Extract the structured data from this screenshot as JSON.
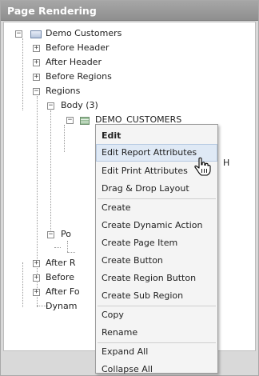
{
  "panel": {
    "title": "Page Rendering"
  },
  "tree": {
    "root": "Demo Customers",
    "before_header": "Before Header",
    "after_header": "After Header",
    "before_regions": "Before Regions",
    "regions": "Regions",
    "body": "Body (3)",
    "demo_customers": "DEMO_CUSTOMERS",
    "partial_po": "Po",
    "partial_after_r": "After R",
    "partial_before": "Before",
    "partial_after_f": "After Fo",
    "partial_dynam": "Dynam",
    "hidden_text_h": "H"
  },
  "context_menu": {
    "items": [
      {
        "label": "Edit"
      },
      {
        "label": "Edit Report Attributes"
      },
      {
        "label": "Edit Print Attributes"
      },
      {
        "label": "Drag & Drop Layout"
      },
      {
        "label": "Create"
      },
      {
        "label": "Create Dynamic Action"
      },
      {
        "label": "Create Page Item"
      },
      {
        "label": "Create Button"
      },
      {
        "label": "Create Region Button"
      },
      {
        "label": "Create Sub Region"
      },
      {
        "label": "Copy"
      },
      {
        "label": "Rename"
      },
      {
        "label": "Expand All"
      },
      {
        "label": "Collapse All"
      }
    ]
  },
  "icons": {
    "collapse": "minus-box-icon",
    "expand": "plus-box-icon",
    "page": "page-icon",
    "report": "report-region-icon",
    "cursor": "hand-pointer-cursor-icon"
  }
}
